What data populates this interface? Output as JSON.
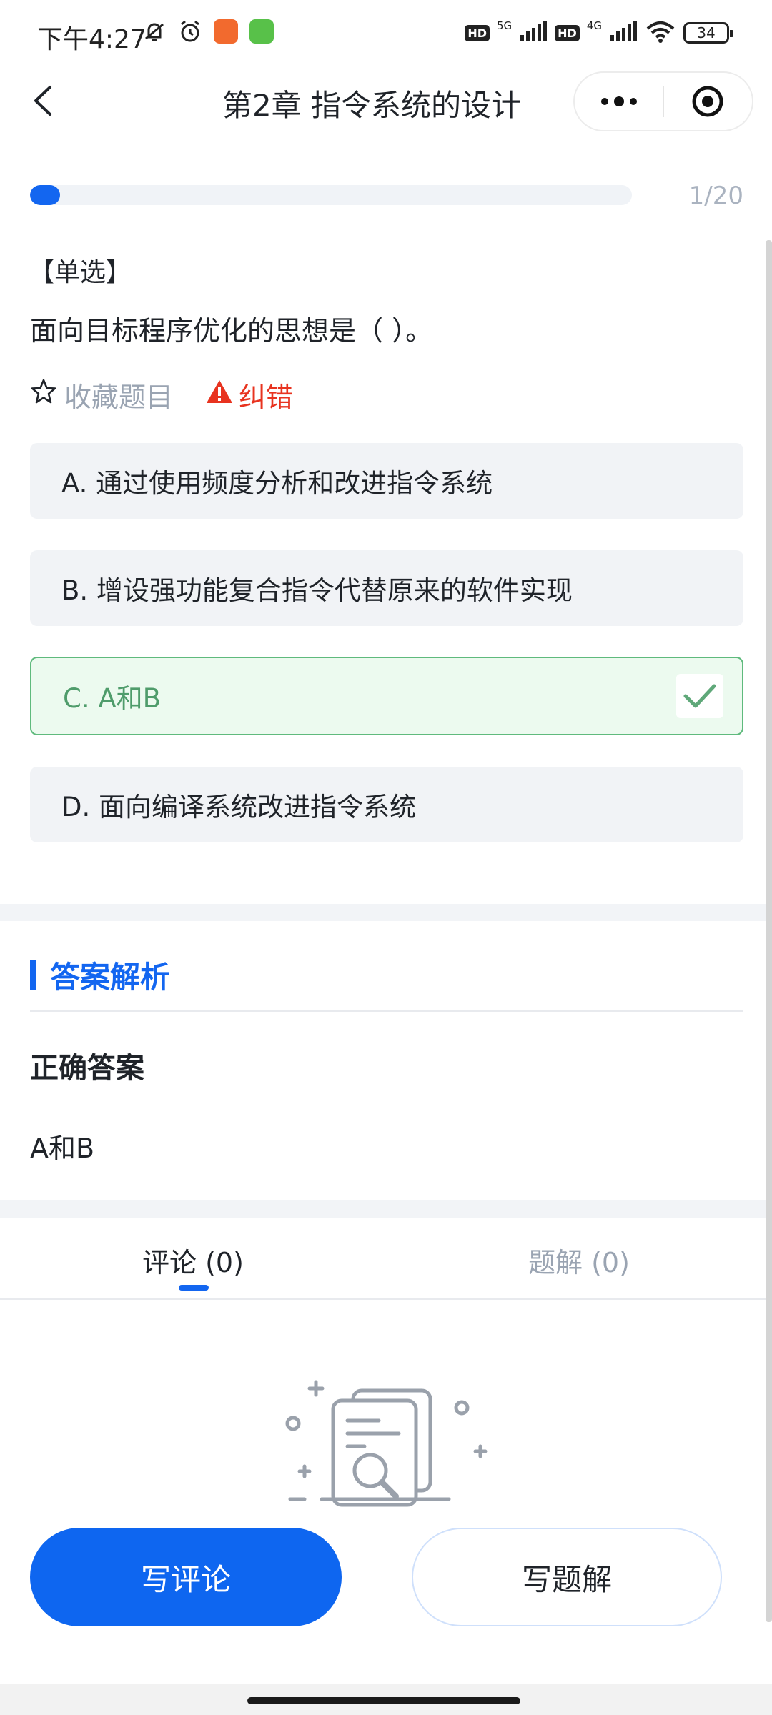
{
  "status_bar": {
    "time": "下午4:27",
    "left_icons": [
      "mute-bell-icon",
      "alarm-icon",
      "app-orange-icon",
      "app-green-icon"
    ],
    "hd1": "HD",
    "net1": "5G",
    "hd2": "HD",
    "net2": "4G",
    "battery": "34"
  },
  "nav": {
    "title": "第2章  指令系统的设计",
    "back_icon": "chevron-left-icon",
    "more_icon": "more-dots-icon",
    "target_icon": "target-icon"
  },
  "progress": {
    "text": "1/20",
    "fraction": 0.05,
    "color": "#1366f0"
  },
  "question": {
    "type": "【单选】",
    "text": "面向目标程序优化的思想是（   ）。",
    "favorite_label": "收藏题目",
    "report_label": "纠错"
  },
  "options": [
    {
      "label": "A. 通过使用频度分析和改进指令系统",
      "state": "normal"
    },
    {
      "label": "B. 增设强功能复合指令代替原来的软件实现",
      "state": "normal"
    },
    {
      "label": "C. A和B",
      "state": "correct"
    },
    {
      "label": "D. 面向编译系统改进指令系统",
      "state": "normal"
    }
  ],
  "analysis": {
    "title": "答案解析",
    "correct_label": "正确答案",
    "correct_value": "A和B"
  },
  "tabs": {
    "comments": "评论 (0)",
    "solutions": "题解 (0)"
  },
  "buttons": {
    "write_comment": "写评论",
    "write_solution": "写题解"
  },
  "colors": {
    "accent": "#1366f0",
    "correct_green": "#5fba7d",
    "error_red": "#e8331f"
  }
}
